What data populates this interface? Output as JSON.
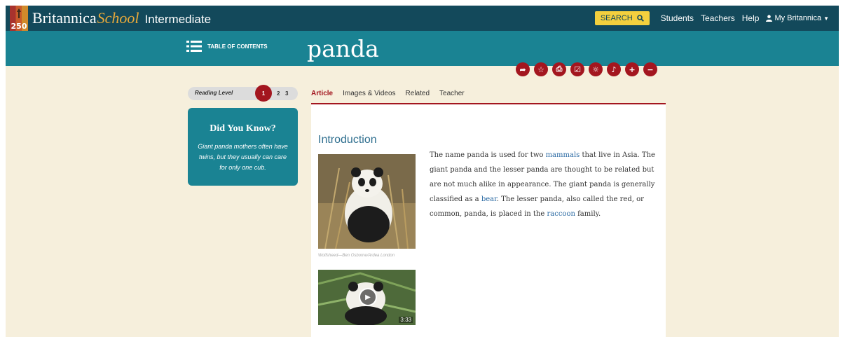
{
  "header": {
    "logo_number": "250",
    "brand_name": "Britannica",
    "brand_school": "School",
    "level": "Intermediate",
    "search_label": "SEARCH",
    "links": [
      "Students",
      "Teachers",
      "Help"
    ],
    "account_label": "My Britannica"
  },
  "band": {
    "toc_label": "TABLE OF CONTENTS",
    "page_title": "panda"
  },
  "actions": [
    "share-icon",
    "star-icon",
    "print-icon",
    "checkbox-icon",
    "globe-icon",
    "audio-icon",
    "zoom-in-icon",
    "zoom-out-icon"
  ],
  "reading_level": {
    "label": "Reading Level",
    "levels": [
      "1",
      "2",
      "3"
    ],
    "selected": "1"
  },
  "did_you_know": {
    "title": "Did You Know?",
    "text": "Giant panda mothers often have twins, but they usually can care for only one cub."
  },
  "tabs": [
    "Article",
    "Images & Videos",
    "Related",
    "Teacher"
  ],
  "article": {
    "heading": "Introduction",
    "photo_credit": "Wolfsheed—Ben Osborne/Ardea London",
    "video_duration": "3:33",
    "text_parts": {
      "p1": "The name panda is used for two ",
      "link_mammals": "mammals",
      "p2": " that live in Asia. The giant panda and the lesser panda are thought to be related but are not much alike in appearance. The giant panda is generally classified as a ",
      "link_bear": "bear",
      "p3": ". The lesser panda, also called the red, or common, panda, is placed in the ",
      "link_raccoon": "raccoon",
      "p4": " family."
    }
  },
  "colors": {
    "topbar": "#13495b",
    "band": "#1a8393",
    "accent": "#a3161f",
    "background": "#f6efdc",
    "search": "#f3d03e"
  }
}
